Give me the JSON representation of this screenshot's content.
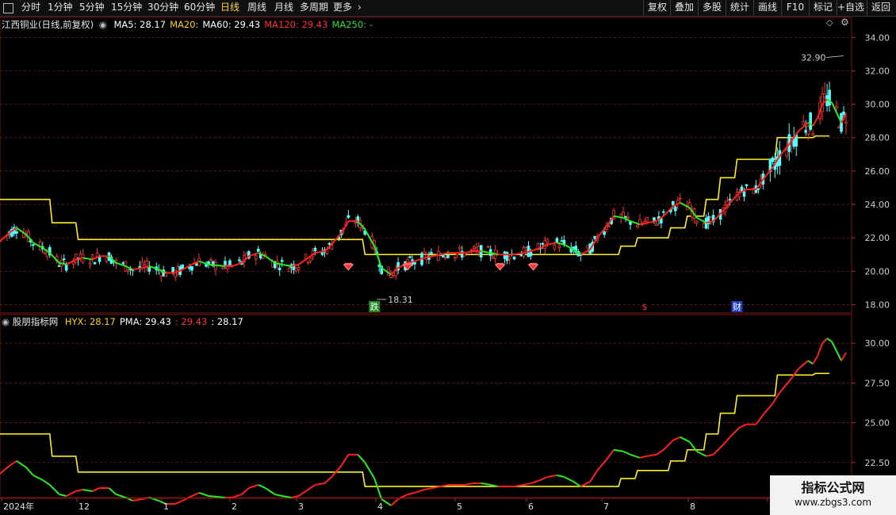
{
  "toolbar": {
    "left": [
      {
        "label": "分时",
        "x": 27
      },
      {
        "label": "1分钟",
        "x": 60
      },
      {
        "label": "5分钟",
        "x": 100
      },
      {
        "label": "15分钟",
        "x": 140
      },
      {
        "label": "30分钟",
        "x": 186
      },
      {
        "label": "60分钟",
        "x": 232
      },
      {
        "label": "日线",
        "x": 278,
        "active": true
      },
      {
        "label": "周线",
        "x": 312
      },
      {
        "label": "月线",
        "x": 346
      },
      {
        "label": "多周期",
        "x": 378
      },
      {
        "label": "更多",
        "x": 420
      }
    ],
    "right": [
      {
        "label": "复权",
        "x": 811
      },
      {
        "label": "叠加",
        "x": 845
      },
      {
        "label": "多股",
        "x": 880
      },
      {
        "label": "统计",
        "x": 915
      },
      {
        "label": "画线",
        "x": 950
      },
      {
        "label": "F10",
        "x": 985
      },
      {
        "label": "标记",
        "x": 1020
      },
      {
        "label": "+自选",
        "x": 1055
      },
      {
        "label": "返回",
        "x": 1093
      }
    ]
  },
  "main_panel": {
    "title": "江西铜业(日线,前复权)",
    "legend": [
      {
        "label": "MA5: 28.17",
        "color": "#ffffff"
      },
      {
        "label": "MA20:",
        "color": "#ffd400"
      },
      {
        "label": "MA60: 29.43",
        "color": "#ffffff"
      },
      {
        "label": "MA120: 29.43",
        "color": "#ff3333"
      },
      {
        "label": "MA250: -",
        "color": "#33dd33"
      }
    ],
    "y_ticks": [
      "34.00",
      "32.00",
      "30.00",
      "28.00",
      "26.00",
      "24.00",
      "22.00",
      "20.00",
      "18.00"
    ],
    "high_label": "32.90",
    "low_label": "18.31",
    "markers": [
      {
        "text": "跌",
        "bg": "#1f8a1f",
        "color": "#ffffff"
      },
      {
        "text": "$",
        "bg": "#000000",
        "color": "#ff3333"
      },
      {
        "text": "财",
        "bg": "#1f3fbf",
        "color": "#ffffff"
      }
    ]
  },
  "sub_panel": {
    "title": "股朋指标网",
    "legend": [
      {
        "label": "HYX: 28.17",
        "color": "#ffd400"
      },
      {
        "label": "PMA: 29.43",
        "color": "#ffffff"
      },
      {
        "label": ": 29.43",
        "color": "#ff3333"
      },
      {
        "label": ": 28.17",
        "color": "#ffffff"
      }
    ],
    "y_ticks": [
      "30.00",
      "27.50",
      "25.00",
      "22.50"
    ]
  },
  "date_axis": [
    "2024年",
    "12",
    "1",
    "2",
    "3",
    "4",
    "5",
    "6",
    "7",
    "8",
    "2"
  ],
  "watermark": {
    "title": "指标公式网",
    "url": "www.zbgs3.com"
  },
  "colors": {
    "up": "#ff3232",
    "down": "#54ffff",
    "ma_up": "#ff2020",
    "ma_down": "#22ee22",
    "stair": "#ffee22",
    "grid": "#8b1a1a"
  },
  "chart_data": {
    "type": "candlestick",
    "y_range": [
      17.5,
      35.2
    ],
    "sub_y_range": [
      20.3,
      31.8
    ],
    "stair_levels": [
      {
        "from": "2024-11-01",
        "to": "2024-11-22",
        "value": 24.3
      },
      {
        "from": "2024-11-23",
        "to": "2024-12-03",
        "value": 22.9
      },
      {
        "from": "2024-12-04",
        "to": "2025-04-03",
        "value": 21.9
      },
      {
        "from": "2025-04-04",
        "to": "2025-07-20",
        "value": 21.0
      },
      {
        "from": "2025-07-21",
        "to": "2025-07-27",
        "value": 21.5
      },
      {
        "from": "2025-07-28",
        "to": "2025-08-10",
        "value": 22.0
      },
      {
        "from": "2025-08-11",
        "to": "2025-08-17",
        "value": 22.6
      },
      {
        "from": "2025-08-18",
        "to": "2025-08-25",
        "value": 23.3
      },
      {
        "from": "2025-08-26",
        "to": "2025-08-31",
        "value": 24.3
      },
      {
        "from": "2025-09-01",
        "to": "2025-09-07",
        "value": 25.6
      },
      {
        "from": "2025-09-08",
        "to": "2025-09-24",
        "value": 26.7
      },
      {
        "from": "2025-09-25",
        "to": "2025-10-10",
        "value": 28.0
      },
      {
        "from": "2025-10-11",
        "to": "2025-10-17",
        "value": 28.1
      }
    ],
    "ma_series": [
      [
        "2024-11-01",
        21.8
      ],
      [
        "2024-11-05",
        22.3
      ],
      [
        "2024-11-08",
        22.6
      ],
      [
        "2024-11-12",
        22.2
      ],
      [
        "2024-11-15",
        21.7
      ],
      [
        "2024-11-19",
        21.4
      ],
      [
        "2024-11-22",
        21.1
      ],
      [
        "2024-11-26",
        20.5
      ],
      [
        "2024-11-29",
        20.4
      ],
      [
        "2024-12-03",
        20.7
      ],
      [
        "2024-12-06",
        20.8
      ],
      [
        "2024-12-10",
        20.7
      ],
      [
        "2024-12-13",
        20.9
      ],
      [
        "2024-12-17",
        20.9
      ],
      [
        "2024-12-20",
        20.5
      ],
      [
        "2024-12-24",
        20.3
      ],
      [
        "2024-12-27",
        20.1
      ],
      [
        "2024-12-31",
        20.2
      ],
      [
        "2025-01-03",
        20.3
      ],
      [
        "2025-01-07",
        20.1
      ],
      [
        "2025-01-10",
        19.9
      ],
      [
        "2025-01-14",
        19.9
      ],
      [
        "2025-01-17",
        20.1
      ],
      [
        "2025-01-21",
        20.4
      ],
      [
        "2025-01-24",
        20.6
      ],
      [
        "2025-01-28",
        20.4
      ],
      [
        "2025-02-04",
        20.3
      ],
      [
        "2025-02-07",
        20.3
      ],
      [
        "2025-02-11",
        20.5
      ],
      [
        "2025-02-14",
        20.9
      ],
      [
        "2025-02-18",
        21.1
      ],
      [
        "2025-02-21",
        20.9
      ],
      [
        "2025-02-25",
        20.5
      ],
      [
        "2025-02-28",
        20.4
      ],
      [
        "2025-03-04",
        20.3
      ],
      [
        "2025-03-07",
        20.4
      ],
      [
        "2025-03-11",
        20.8
      ],
      [
        "2025-03-14",
        21.1
      ],
      [
        "2025-03-18",
        21.2
      ],
      [
        "2025-03-21",
        21.6
      ],
      [
        "2025-03-25",
        22.3
      ],
      [
        "2025-03-28",
        23.0
      ],
      [
        "2025-04-01",
        23.0
      ],
      [
        "2025-04-04",
        22.5
      ],
      [
        "2025-04-08",
        21.5
      ],
      [
        "2025-04-11",
        20.2
      ],
      [
        "2025-04-15",
        19.8
      ],
      [
        "2025-04-18",
        20.2
      ],
      [
        "2025-04-22",
        20.5
      ],
      [
        "2025-04-25",
        20.6
      ],
      [
        "2025-04-29",
        20.8
      ],
      [
        "2025-05-06",
        21.0
      ],
      [
        "2025-05-09",
        21.1
      ],
      [
        "2025-05-13",
        21.1
      ],
      [
        "2025-05-16",
        21.1
      ],
      [
        "2025-05-20",
        21.2
      ],
      [
        "2025-05-23",
        21.2
      ],
      [
        "2025-05-27",
        21.1
      ],
      [
        "2025-05-30",
        21.0
      ],
      [
        "2025-06-03",
        21.0
      ],
      [
        "2025-06-06",
        21.0
      ],
      [
        "2025-06-10",
        21.1
      ],
      [
        "2025-06-13",
        21.2
      ],
      [
        "2025-06-17",
        21.4
      ],
      [
        "2025-06-20",
        21.6
      ],
      [
        "2025-06-24",
        21.7
      ],
      [
        "2025-06-27",
        21.6
      ],
      [
        "2025-07-01",
        21.3
      ],
      [
        "2025-07-04",
        21.0
      ],
      [
        "2025-07-08",
        21.3
      ],
      [
        "2025-07-11",
        22.0
      ],
      [
        "2025-07-15",
        22.7
      ],
      [
        "2025-07-18",
        23.3
      ],
      [
        "2025-07-22",
        23.2
      ],
      [
        "2025-07-25",
        23.0
      ],
      [
        "2025-07-29",
        22.8
      ],
      [
        "2025-08-01",
        22.9
      ],
      [
        "2025-08-05",
        23.0
      ],
      [
        "2025-08-08",
        23.3
      ],
      [
        "2025-08-12",
        23.9
      ],
      [
        "2025-08-15",
        24.1
      ],
      [
        "2025-08-19",
        23.8
      ],
      [
        "2025-08-22",
        23.2
      ],
      [
        "2025-08-26",
        22.9
      ],
      [
        "2025-08-29",
        23.0
      ],
      [
        "2025-09-02",
        23.6
      ],
      [
        "2025-09-05",
        24.1
      ],
      [
        "2025-09-09",
        24.7
      ],
      [
        "2025-09-12",
        24.9
      ],
      [
        "2025-09-16",
        24.9
      ],
      [
        "2025-09-19",
        25.5
      ],
      [
        "2025-09-23",
        26.2
      ],
      [
        "2025-09-26",
        26.9
      ],
      [
        "2025-09-30",
        27.6
      ],
      [
        "2025-10-04",
        28.4
      ],
      [
        "2025-10-08",
        28.9
      ],
      [
        "2025-10-10",
        28.7
      ],
      [
        "2025-10-12",
        29.2
      ],
      [
        "2025-10-14",
        30.0
      ],
      [
        "2025-10-16",
        30.3
      ],
      [
        "2025-10-18",
        30.1
      ],
      [
        "2025-10-20",
        29.5
      ],
      [
        "2025-10-22",
        28.9
      ],
      [
        "2025-10-24",
        29.4
      ]
    ]
  }
}
